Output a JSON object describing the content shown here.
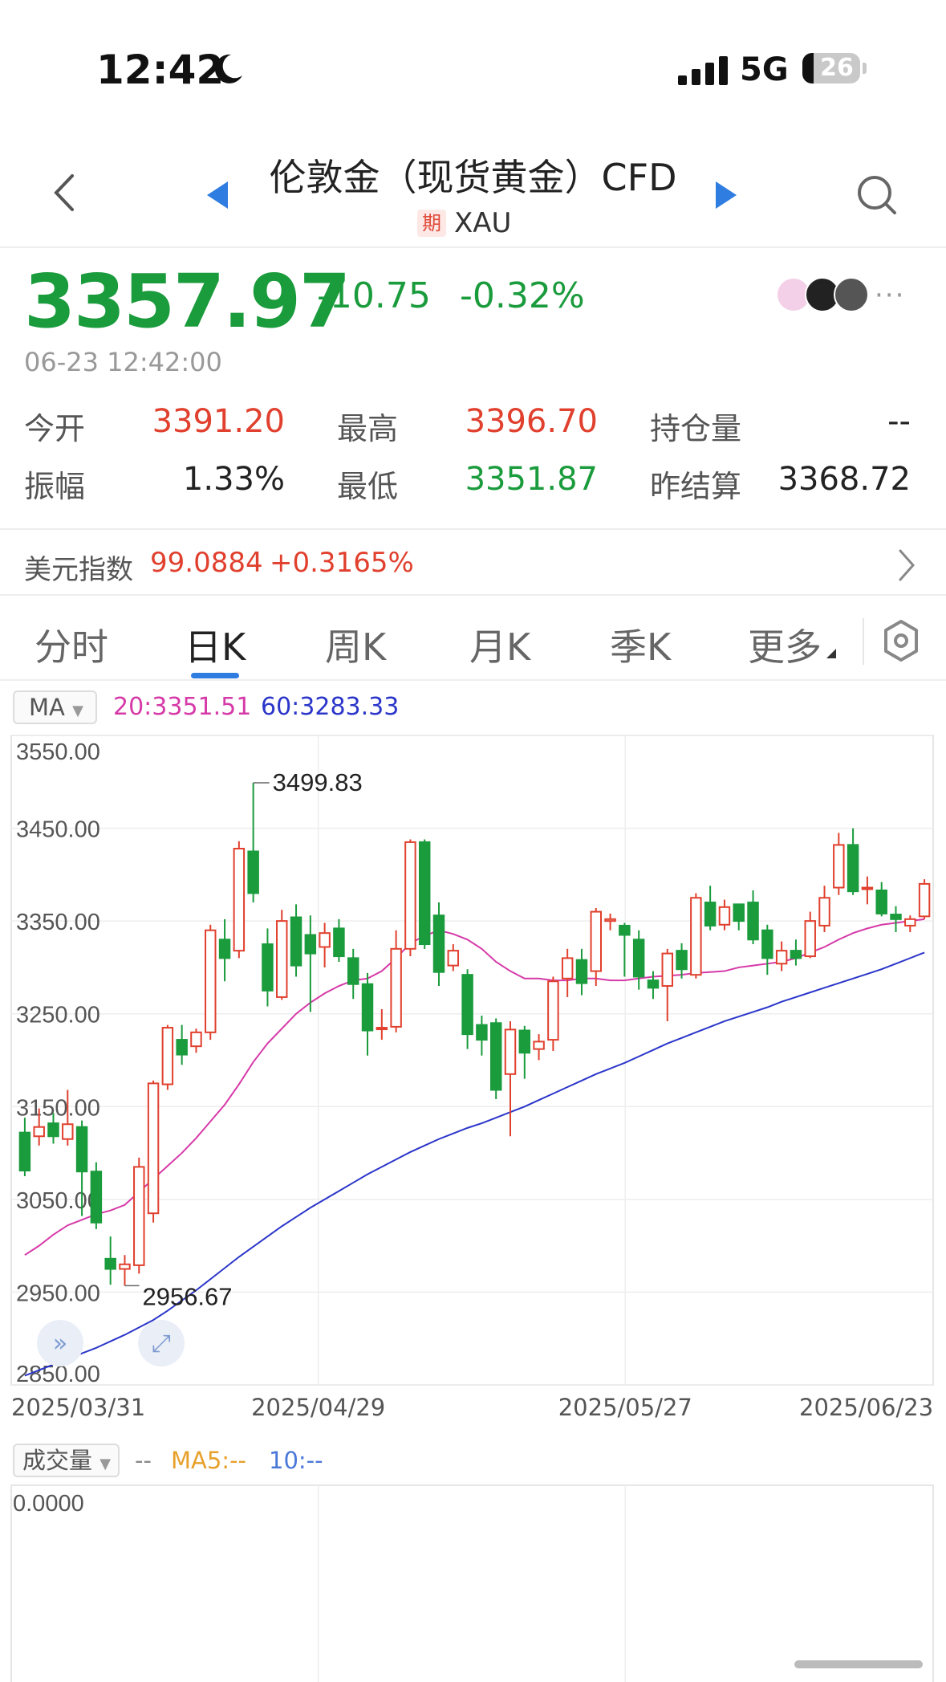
{
  "status_bar": {
    "time": "12:42",
    "network": "5G",
    "battery": "26"
  },
  "header": {
    "title": "伦敦金（现货黄金）CFD",
    "badge": "期",
    "symbol": "XAU"
  },
  "quote": {
    "price": "3357.97",
    "change": "-10.75",
    "change_pct": "-0.32%",
    "datetime": "06-23 12:42:00",
    "stats": [
      {
        "label": "今开",
        "value": "3391.20",
        "color": "red"
      },
      {
        "label": "最高",
        "value": "3396.70",
        "color": "red"
      },
      {
        "label": "持仓量",
        "value": "--",
        "color": "dark"
      },
      {
        "label": "振幅",
        "value": "1.33%",
        "color": "dark"
      },
      {
        "label": "最低",
        "value": "3351.87",
        "color": "green"
      },
      {
        "label": "昨结算",
        "value": "3368.72",
        "color": "dark"
      }
    ]
  },
  "usd_index": {
    "label": "美元指数",
    "value": "99.0884",
    "change": "+0.3165%"
  },
  "tabs": [
    "分时",
    "日K",
    "周K",
    "月K",
    "季K",
    "更多"
  ],
  "active_tab": "日K",
  "ma_legend": {
    "selector": "MA",
    "ma20": "20:3351.51",
    "ma60": "60:3283.33"
  },
  "volume_legend": {
    "selector": "成交量",
    "dash": "--",
    "ma5": "MA5:--",
    "ma10": "10:--",
    "value": "0.0000"
  },
  "colors": {
    "up": "#e0402d",
    "down": "#1a9b3c",
    "ma20": "#d63aa8",
    "ma60": "#2b36c9",
    "accent": "#2f7de0"
  },
  "chart_data": {
    "type": "candlestick",
    "y_ticks": [
      "3550.00",
      "3450.00",
      "3350.00",
      "3250.00",
      "3150.00",
      "3050.00",
      "2950.00",
      "2850.00"
    ],
    "ylim": [
      2850,
      3550
    ],
    "x_ticks": [
      "2025/03/31",
      "2025/04/29",
      "2025/05/27",
      "2025/06/23"
    ],
    "annotations": {
      "max": "3499.83",
      "min": "2956.67"
    },
    "candles": [
      [
        3122,
        3081,
        3138,
        3075
      ],
      [
        3118,
        3128,
        3148,
        3108
      ],
      [
        3132,
        3118,
        3143,
        3110
      ],
      [
        3115,
        3131,
        3168,
        3108
      ],
      [
        3128,
        3080,
        3135,
        3032
      ],
      [
        3080,
        3025,
        3090,
        3018
      ],
      [
        2986,
        2975,
        3010,
        2958
      ],
      [
        2975,
        2980,
        2990,
        2957
      ],
      [
        2979,
        3085,
        3095,
        2970
      ],
      [
        3035,
        3175,
        3178,
        3025
      ],
      [
        3174,
        3235,
        3238,
        3168
      ],
      [
        3222,
        3206,
        3238,
        3195
      ],
      [
        3215,
        3230,
        3234,
        3208
      ],
      [
        3230,
        3340,
        3346,
        3222
      ],
      [
        3330,
        3310,
        3352,
        3285
      ],
      [
        3318,
        3428,
        3436,
        3310
      ],
      [
        3425,
        3380,
        3499,
        3370
      ],
      [
        3325,
        3275,
        3342,
        3258
      ],
      [
        3268,
        3350,
        3362,
        3265
      ],
      [
        3354,
        3302,
        3368,
        3290
      ],
      [
        3335,
        3315,
        3356,
        3252
      ],
      [
        3322,
        3337,
        3348,
        3300
      ],
      [
        3342,
        3312,
        3352,
        3306
      ],
      [
        3310,
        3282,
        3320,
        3266
      ],
      [
        3282,
        3232,
        3294,
        3205
      ],
      [
        3235,
        3235,
        3255,
        3222
      ],
      [
        3236,
        3320,
        3340,
        3230
      ],
      [
        3320,
        3435,
        3438,
        3312
      ],
      [
        3435,
        3325,
        3438,
        3320
      ],
      [
        3356,
        3295,
        3370,
        3280
      ],
      [
        3302,
        3318,
        3325,
        3296
      ],
      [
        3292,
        3228,
        3298,
        3212
      ],
      [
        3238,
        3222,
        3248,
        3205
      ],
      [
        3240,
        3168,
        3245,
        3158
      ],
      [
        3185,
        3233,
        3242,
        3118
      ],
      [
        3232,
        3208,
        3237,
        3180
      ],
      [
        3212,
        3220,
        3228,
        3200
      ],
      [
        3222,
        3285,
        3290,
        3210
      ],
      [
        3288,
        3310,
        3320,
        3268
      ],
      [
        3308,
        3283,
        3320,
        3270
      ],
      [
        3296,
        3360,
        3364,
        3280
      ],
      [
        3350,
        3352,
        3358,
        3340
      ],
      [
        3345,
        3335,
        3348,
        3290
      ],
      [
        3330,
        3290,
        3340,
        3276
      ],
      [
        3286,
        3278,
        3296,
        3266
      ],
      [
        3280,
        3315,
        3320,
        3242
      ],
      [
        3318,
        3298,
        3326,
        3288
      ],
      [
        3292,
        3375,
        3380,
        3288
      ],
      [
        3370,
        3345,
        3388,
        3340
      ],
      [
        3346,
        3365,
        3373,
        3340
      ],
      [
        3368,
        3350,
        3368,
        3340
      ],
      [
        3370,
        3330,
        3383,
        3325
      ],
      [
        3340,
        3310,
        3346,
        3292
      ],
      [
        3304,
        3318,
        3328,
        3296
      ],
      [
        3318,
        3310,
        3330,
        3302
      ],
      [
        3312,
        3350,
        3360,
        3310
      ],
      [
        3345,
        3375,
        3388,
        3338
      ],
      [
        3386,
        3432,
        3445,
        3378
      ],
      [
        3432,
        3382,
        3450,
        3378
      ],
      [
        3386,
        3386,
        3398,
        3368
      ],
      [
        3383,
        3358,
        3392,
        3355
      ],
      [
        3357,
        3352,
        3366,
        3338
      ],
      [
        3345,
        3352,
        3356,
        3338
      ],
      [
        3355,
        3390,
        3395,
        3352
      ]
    ],
    "ma20": [
      2990,
      3000,
      3012,
      3022,
      3028,
      3034,
      3038,
      3044,
      3058,
      3072,
      3086,
      3100,
      3116,
      3134,
      3152,
      3174,
      3198,
      3218,
      3234,
      3250,
      3262,
      3272,
      3280,
      3286,
      3288,
      3296,
      3310,
      3326,
      3334,
      3340,
      3336,
      3330,
      3320,
      3306,
      3296,
      3288,
      3288,
      3286,
      3286,
      3288,
      3288,
      3286,
      3286,
      3288,
      3290,
      3291,
      3292,
      3294,
      3295,
      3296,
      3300,
      3302,
      3304,
      3306,
      3310,
      3316,
      3322,
      3330,
      3337,
      3342,
      3346,
      3348,
      3350,
      3352
    ],
    "ma60": [
      2860,
      2866,
      2872,
      2878,
      2884,
      2890,
      2897,
      2904,
      2912,
      2920,
      2930,
      2941,
      2952,
      2964,
      2976,
      2988,
      2999,
      3010,
      3021,
      3031,
      3041,
      3050,
      3059,
      3068,
      3077,
      3085,
      3093,
      3101,
      3108,
      3115,
      3121,
      3127,
      3132,
      3138,
      3144,
      3150,
      3157,
      3164,
      3171,
      3178,
      3185,
      3191,
      3197,
      3204,
      3211,
      3218,
      3224,
      3230,
      3236,
      3242,
      3247,
      3252,
      3257,
      3263,
      3268,
      3273,
      3278,
      3283,
      3288,
      3293,
      3298,
      3304,
      3310,
      3316
    ]
  }
}
